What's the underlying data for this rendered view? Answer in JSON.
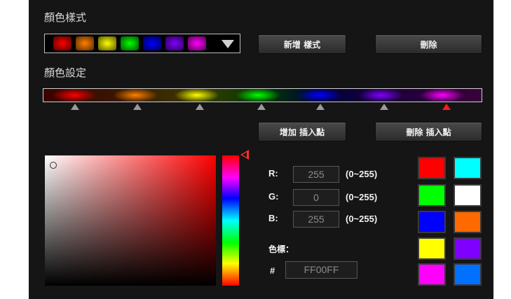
{
  "style_section": {
    "title": "顏色樣式"
  },
  "style_dropdown": {
    "swatches": [
      "#ff0000",
      "#ff8000",
      "#ffff00",
      "#00ff00",
      "#0000ff",
      "#7f00ff",
      "#ff00ff"
    ],
    "arrow_icon": "chevron-down-icon"
  },
  "buttons": {
    "add_style": "新增 樣式",
    "delete": "刪除",
    "add_point": "增加 插入點",
    "delete_point": "刪除 插入點"
  },
  "color_section": {
    "title": "顏色設定"
  },
  "gradient_stops": [
    {
      "color": "#ff0000",
      "active": false
    },
    {
      "color": "#ff8000",
      "active": false
    },
    {
      "color": "#ffff00",
      "active": false
    },
    {
      "color": "#00ff00",
      "active": false
    },
    {
      "color": "#0000ff",
      "active": false
    },
    {
      "color": "#7f00ff",
      "active": false
    },
    {
      "color": "#ff00ff",
      "active": true
    }
  ],
  "rgb": {
    "r_label": "R:",
    "r_value": "255",
    "r_range": "(0~255)",
    "g_label": "G:",
    "g_value": "0",
    "g_range": "(0~255)",
    "b_label": "B:",
    "b_value": "255",
    "b_range": "(0~255)"
  },
  "hex": {
    "label": "色標：",
    "hash": "#",
    "value": "FF00FF"
  },
  "presets": [
    "#ff0000",
    "#00ffff",
    "#00ff00",
    "#ffffff",
    "#0000ff",
    "#ff6a00",
    "#ffff00",
    "#7f00ff",
    "#ff00ff",
    "#0070ff"
  ]
}
